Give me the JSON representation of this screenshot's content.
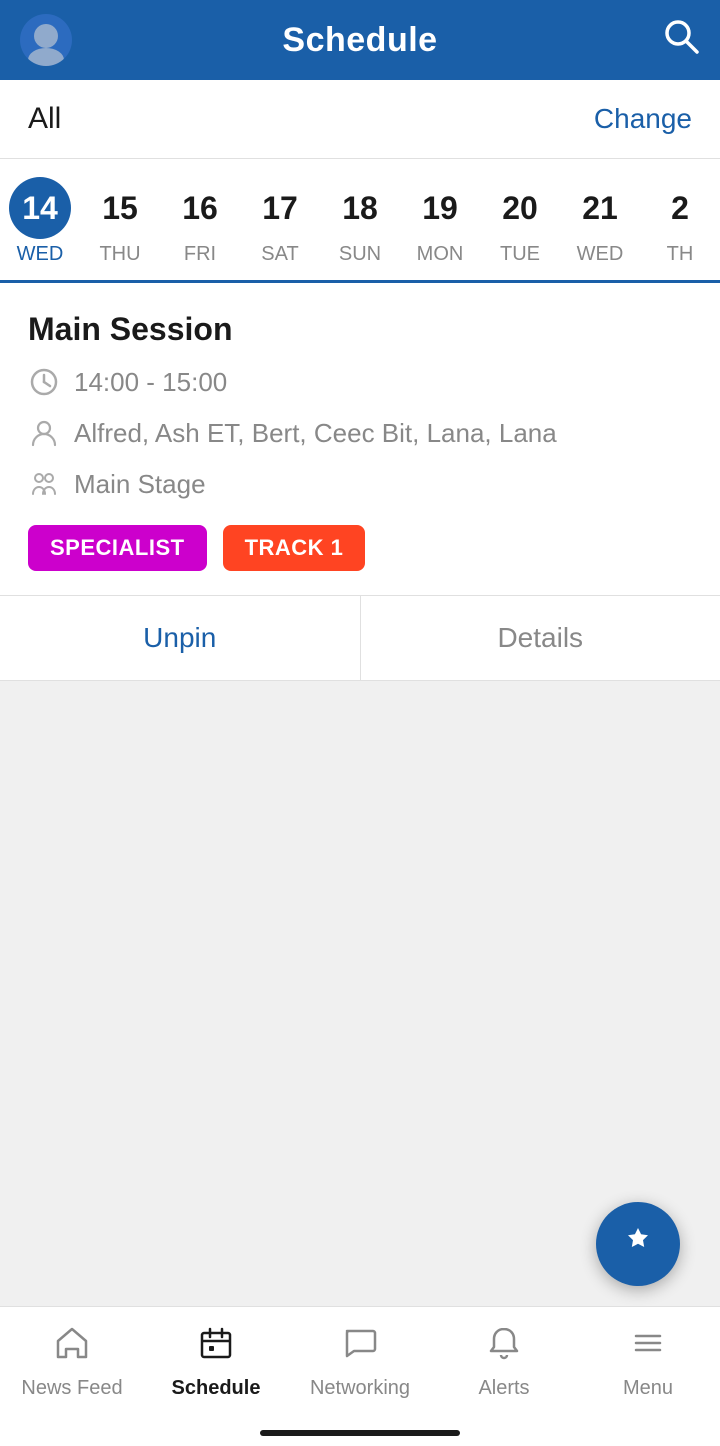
{
  "header": {
    "title": "Schedule",
    "search_aria": "search"
  },
  "filter": {
    "label": "All",
    "change_label": "Change"
  },
  "calendar": {
    "days": [
      {
        "num": "14",
        "label": "WED",
        "active": true
      },
      {
        "num": "15",
        "label": "THU",
        "active": false
      },
      {
        "num": "16",
        "label": "FRI",
        "active": false
      },
      {
        "num": "17",
        "label": "SAT",
        "active": false
      },
      {
        "num": "18",
        "label": "SUN",
        "active": false
      },
      {
        "num": "19",
        "label": "MON",
        "active": false
      },
      {
        "num": "20",
        "label": "TUE",
        "active": false
      },
      {
        "num": "21",
        "label": "WED",
        "active": false
      },
      {
        "num": "2",
        "label": "TH",
        "active": false
      }
    ]
  },
  "session": {
    "title": "Main Session",
    "time": "14:00 - 15:00",
    "speakers": "Alfred, Ash ET, Bert, Ceec Bit, Lana, Lana",
    "location": "Main Stage",
    "tags": [
      {
        "label": "SPECIALIST",
        "type": "specialist"
      },
      {
        "label": "TRACK 1",
        "type": "track1"
      }
    ]
  },
  "actions": {
    "unpin_label": "Unpin",
    "details_label": "Details"
  },
  "fab": {
    "aria": "pin-fab"
  },
  "bottom_nav": {
    "items": [
      {
        "label": "News Feed",
        "icon": "home",
        "active": false
      },
      {
        "label": "Schedule",
        "icon": "calendar",
        "active": true
      },
      {
        "label": "Networking",
        "icon": "chat",
        "active": false
      },
      {
        "label": "Alerts",
        "icon": "bell",
        "active": false
      },
      {
        "label": "Menu",
        "icon": "menu",
        "active": false
      }
    ]
  }
}
